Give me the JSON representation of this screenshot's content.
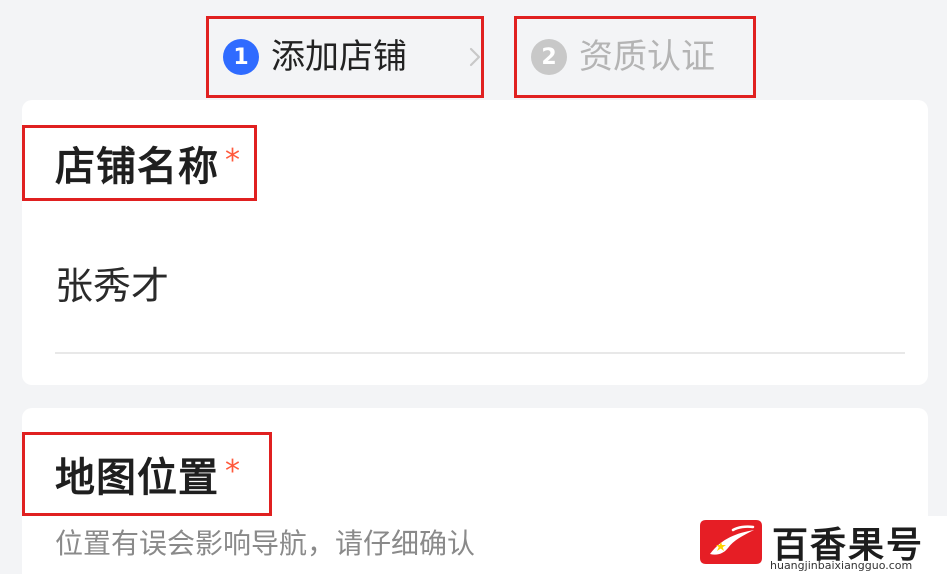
{
  "steps": [
    {
      "number": "1",
      "label": "添加店铺",
      "state": "active"
    },
    {
      "number": "2",
      "label": "资质认证",
      "state": "inactive"
    }
  ],
  "icons": {
    "step_separator": "chevron-right-icon"
  },
  "form": {
    "shop_name": {
      "label": "店铺名称",
      "required_mark": "*",
      "value": "张秀才"
    },
    "map_location": {
      "label": "地图位置",
      "required_mark": "*",
      "hint": "位置有误会影响导航，请仔细确认"
    }
  },
  "watermark": {
    "brand": "百香果号",
    "url": "huangjinbaixiangguo.com"
  },
  "colors": {
    "active_step": "#2f6bff",
    "inactive_step": "#c8c8c8",
    "highlight_box": "#e02020",
    "required_star": "#ff5a3c"
  }
}
